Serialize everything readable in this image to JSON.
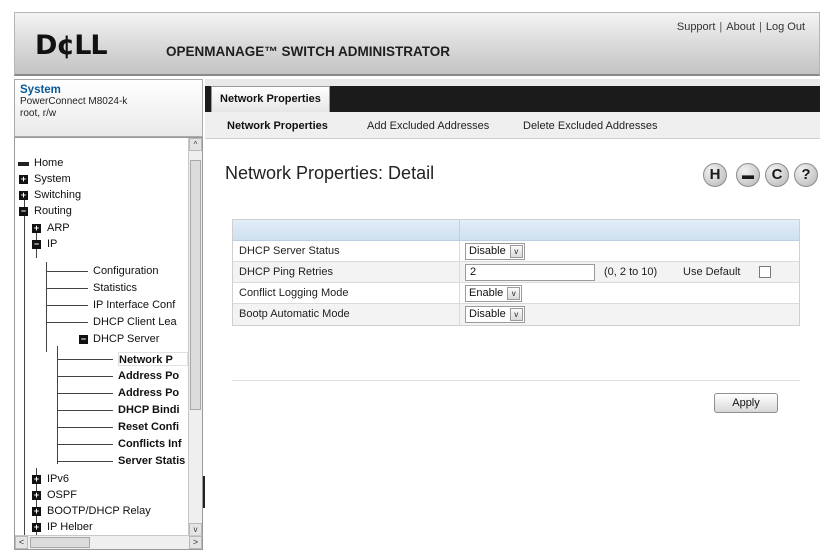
{
  "header": {
    "logo": "D¢LL",
    "title": "OPENMANAGE™ SWITCH ADMINISTRATOR",
    "links": [
      "Support",
      "About",
      "Log Out"
    ],
    "link_separator": "|"
  },
  "system": {
    "title": "System",
    "model": "PowerConnect M8024-k",
    "user": "root, r/w"
  },
  "tree": {
    "items": [
      {
        "label": "Home"
      },
      {
        "label": "System"
      },
      {
        "label": "Switching"
      },
      {
        "label": "Routing"
      },
      {
        "label": "ARP"
      },
      {
        "label": "IP"
      },
      {
        "label": "Configuration"
      },
      {
        "label": "Statistics"
      },
      {
        "label": "IP Interface Conf"
      },
      {
        "label": "DHCP Client Lea"
      },
      {
        "label": "DHCP Server"
      },
      {
        "label": "Network P"
      },
      {
        "label": "Address Po"
      },
      {
        "label": "Address Po"
      },
      {
        "label": "DHCP Bindi"
      },
      {
        "label": "Reset Confi"
      },
      {
        "label": "Conflicts Inf"
      },
      {
        "label": "Server Statis"
      },
      {
        "label": "IPv6"
      },
      {
        "label": "OSPF"
      },
      {
        "label": "BOOTP/DHCP Relay"
      },
      {
        "label": "IP Helper"
      }
    ],
    "scroll_left": "<",
    "scroll_right": ">",
    "scroll_up": "^",
    "scroll_down": "v"
  },
  "tabs": {
    "active": "Network Properties",
    "subtabs": [
      "Network Properties",
      "Add Excluded Addresses",
      "Delete Excluded Addresses"
    ]
  },
  "page": {
    "title": "Network Properties: Detail",
    "toolbar_icons": [
      {
        "name": "save-icon",
        "glyph": "H"
      },
      {
        "name": "print-icon",
        "glyph": "▬"
      },
      {
        "name": "refresh-icon",
        "glyph": "C"
      },
      {
        "name": "help-icon",
        "glyph": "?"
      }
    ]
  },
  "form": {
    "rows": [
      {
        "label": "DHCP Server Status",
        "value": "Disable"
      },
      {
        "label": "DHCP Ping Retries",
        "value": "2",
        "range": "(0, 2 to 10)",
        "use_default": "Use Default"
      },
      {
        "label": "Conflict Logging Mode",
        "value": "Enable"
      },
      {
        "label": "Bootp Automatic Mode",
        "value": "Disable"
      }
    ],
    "dropdown_arrow": "v"
  },
  "actions": {
    "apply": "Apply"
  }
}
